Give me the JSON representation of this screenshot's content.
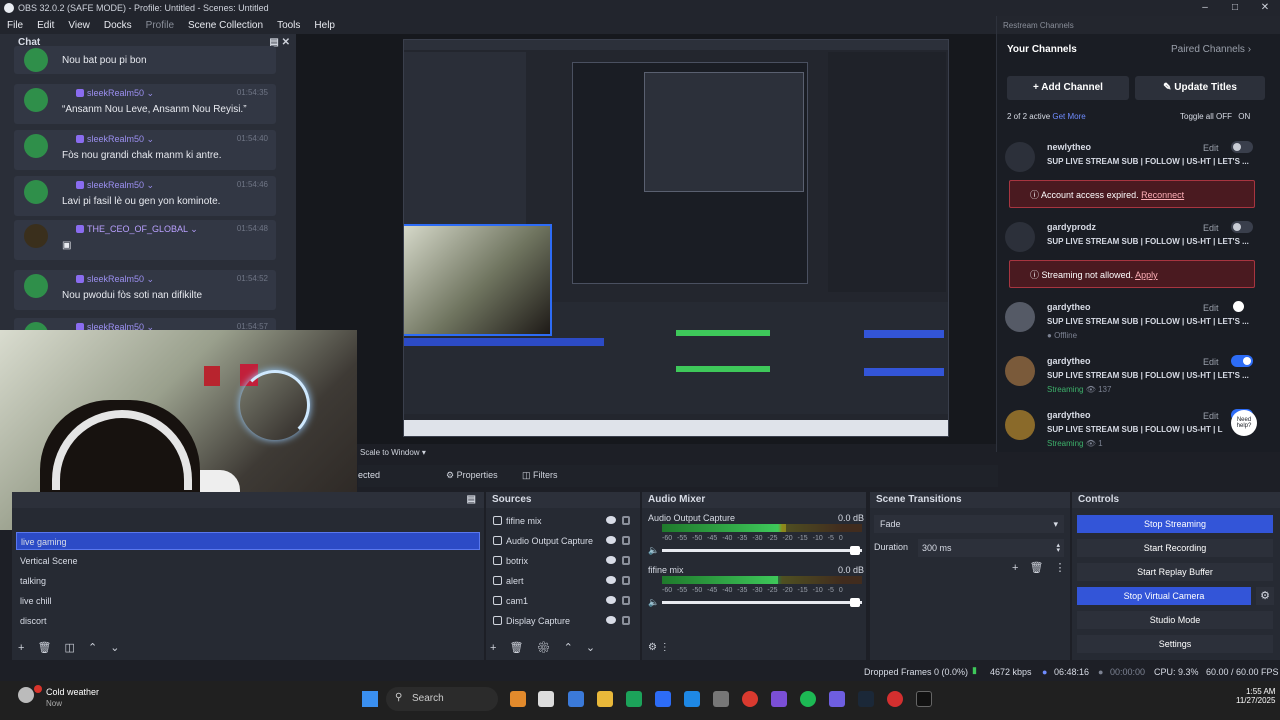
{
  "window": {
    "title": "OBS 32.0.2 (SAFE MODE) - Profile: Untitled - Scenes: Untitled"
  },
  "menu": [
    "File",
    "Edit",
    "View",
    "Docks",
    "Profile",
    "Scene Collection",
    "Tools",
    "Help"
  ],
  "chat": {
    "title": "Chat",
    "messages": [
      {
        "user": "",
        "time": "",
        "text": "Nou bat pou pi bon"
      },
      {
        "user": "sleekRealm50",
        "time": "01:54:35",
        "text": "“Ansanm Nou Leve, Ansanm Nou Reyisi.”"
      },
      {
        "user": "sleekRealm50",
        "time": "01:54:40",
        "text": "Fòs nou grandi chak manm ki antre."
      },
      {
        "user": "sleekRealm50",
        "time": "01:54:46",
        "text": "Lavi pi fasil lè ou gen yon kominote."
      },
      {
        "user": "THE_CEO_OF_GLOBAL",
        "time": "01:54:48",
        "text": ""
      },
      {
        "user": "sleekRealm50",
        "time": "01:54:52",
        "text": "Nou pwodui fòs soti nan difikilte"
      },
      {
        "user": "sleekRealm50",
        "time": "01:54:57",
        "text": ""
      }
    ]
  },
  "preview": {
    "scale_label": "Scale to Window",
    "selected_label": "ected"
  },
  "props": {
    "properties": "Properties",
    "filters": "Filters"
  },
  "restream": {
    "dock_title": "Restream Channels",
    "your_channels": "Your Channels",
    "paired_channels": "Paired Channels",
    "add_channel": "Add Channel",
    "update_titles": "Update Titles",
    "active_count": "2 of 2 active",
    "get_more": "Get More",
    "toggle_all": "Toggle all",
    "off": "OFF",
    "on": "ON",
    "edit": "Edit",
    "channels": [
      {
        "name": "newlytheo",
        "title": "SUP LIVE STREAM SUB | FOLLOW | US-HT | LET'S ...",
        "status": "",
        "on": false
      },
      {
        "name": "gardyprodz",
        "title": "SUP LIVE STREAM SUB | FOLLOW | US-HT | LET'S ...",
        "status": "",
        "on": false
      },
      {
        "name": "gardytheo",
        "title": "SUP LIVE STREAM SUB | FOLLOW | US-HT | LET'S ...",
        "status": "Offline",
        "on": false
      },
      {
        "name": "gardytheo",
        "title": "SUP LIVE STREAM SUB | FOLLOW | US-HT | LET'S ...",
        "status": "Streaming",
        "viewers": "137",
        "on": true
      },
      {
        "name": "gardytheo",
        "title": "SUP LIVE STREAM SUB | FOLLOW | US-HT | LET'S ...",
        "status": "Streaming",
        "viewers": "1",
        "on": true
      }
    ],
    "alerts": [
      {
        "text": "Account access expired.",
        "action": "Reconnect"
      },
      {
        "text": "Streaming not allowed.",
        "action": "Apply"
      }
    ],
    "need_help": "Need help?"
  },
  "scenes": {
    "items": [
      "live gaming",
      "Vertical Scene",
      "talking",
      "live chill",
      "discort"
    ],
    "selected": 0
  },
  "sources": {
    "title": "Sources",
    "items": [
      "fifine mix",
      "Audio Output Capture",
      "botrix",
      "alert",
      "cam1",
      "Display Capture"
    ]
  },
  "mixer": {
    "title": "Audio Mixer",
    "channels": [
      {
        "name": "Audio Output Capture",
        "db": "0.0 dB",
        "level": 0.62
      },
      {
        "name": "fifine mix",
        "db": "0.0 dB",
        "level": 0.58
      }
    ],
    "scale": [
      "-60",
      "-55",
      "-50",
      "-45",
      "-40",
      "-35",
      "-30",
      "-25",
      "-20",
      "-15",
      "-10",
      "-5",
      "0"
    ]
  },
  "transitions": {
    "title": "Scene Transitions",
    "type": "Fade",
    "duration_label": "Duration",
    "duration": "300 ms"
  },
  "controls": {
    "title": "Controls",
    "buttons": [
      "Stop Streaming",
      "Start Recording",
      "Start Replay Buffer",
      "Stop Virtual Camera",
      "Studio Mode",
      "Settings"
    ]
  },
  "status": {
    "dropped": "Dropped Frames 0 (0.0%)",
    "bitrate": "4672 kbps",
    "live_time": "06:48:16",
    "rec_time": "00:00:00",
    "cpu": "CPU: 9.3%",
    "fps": "60.00 / 60.00 FPS"
  },
  "taskbar": {
    "weather_title": "Cold weather",
    "weather_sub": "Now",
    "search": "Search",
    "time": "1:55 AM",
    "date": "11/27/2025"
  },
  "colors": {
    "accent": "#3355d8",
    "live": "#3db06a",
    "alert": "#a83540"
  }
}
